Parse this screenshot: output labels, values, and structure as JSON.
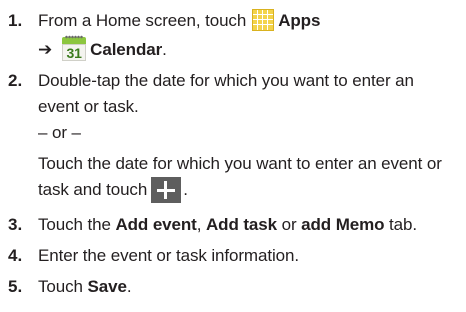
{
  "steps": [
    {
      "number": "1.",
      "line1": "From a Home screen, touch",
      "apps_label": "Apps",
      "arrow": "➔",
      "calendar_icon_day": "31",
      "calendar_label": "Calendar",
      "period": "."
    },
    {
      "number": "2.",
      "line1": "Double-tap the date for which you want to enter an",
      "line2": "event or task.",
      "or": "– or –",
      "line3": "Touch the date for which you want to enter an event or",
      "line4": "task and touch",
      "period": "."
    },
    {
      "number": "3.",
      "text_a": "Touch the ",
      "bold_a": "Add event",
      "text_b": ", ",
      "bold_b": "Add task",
      "text_c": " or ",
      "bold_c": "add Memo",
      "text_d": " tab."
    },
    {
      "number": "4.",
      "text": "Enter the event or task information."
    },
    {
      "number": "5.",
      "text_a": "Touch ",
      "bold_a": "Save",
      "text_b": "."
    }
  ],
  "icons": {
    "apps": "apps-grid-icon",
    "calendar": "calendar-icon",
    "plus": "plus-icon"
  }
}
